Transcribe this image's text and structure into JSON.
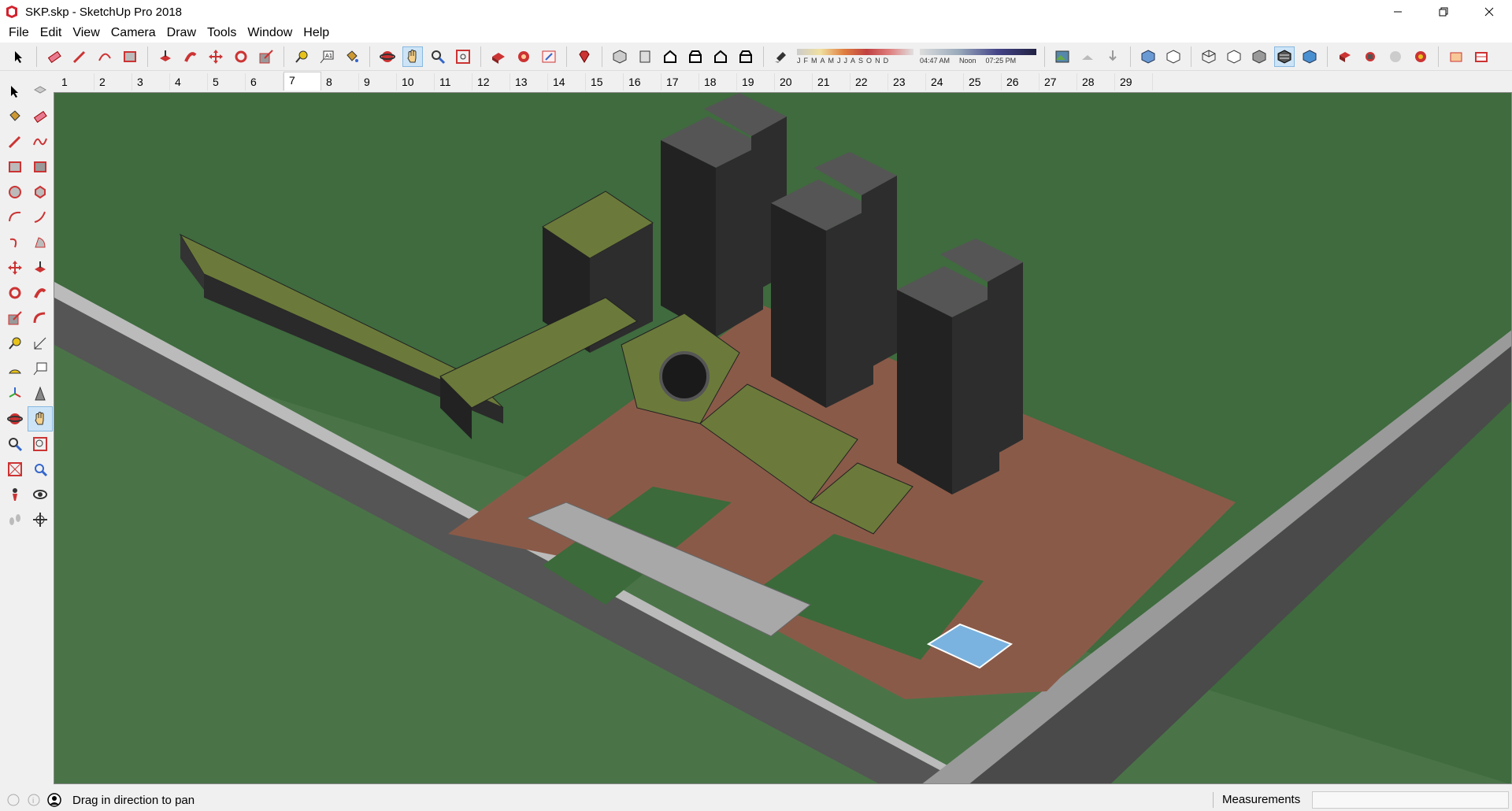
{
  "window": {
    "title": "SKP.skp - SketchUp Pro 2018"
  },
  "menu": [
    "File",
    "Edit",
    "View",
    "Camera",
    "Draw",
    "Tools",
    "Window",
    "Help"
  ],
  "shadow": {
    "months": [
      "J",
      "F",
      "M",
      "A",
      "M",
      "J",
      "J",
      "A",
      "S",
      "O",
      "N",
      "D"
    ],
    "time_start": "04:47 AM",
    "time_noon": "Noon",
    "time_end": "07:25 PM"
  },
  "scenes": [
    "1",
    "2",
    "3",
    "4",
    "5",
    "6",
    "7",
    "8",
    "9",
    "10",
    "11",
    "12",
    "13",
    "14",
    "15",
    "16",
    "17",
    "18",
    "19",
    "20",
    "21",
    "22",
    "23",
    "24",
    "25",
    "26",
    "27",
    "28",
    "29"
  ],
  "active_scene": "7",
  "status": {
    "hint": "Drag in direction to pan",
    "measurements_label": "Measurements",
    "measurements_value": ""
  },
  "colors": {
    "ground": "#3f6b3e",
    "road": "#5a5a5a",
    "tower": "#2a2a2a",
    "roof_green": "#6b7a3a",
    "plaza": "#8a5a48"
  }
}
